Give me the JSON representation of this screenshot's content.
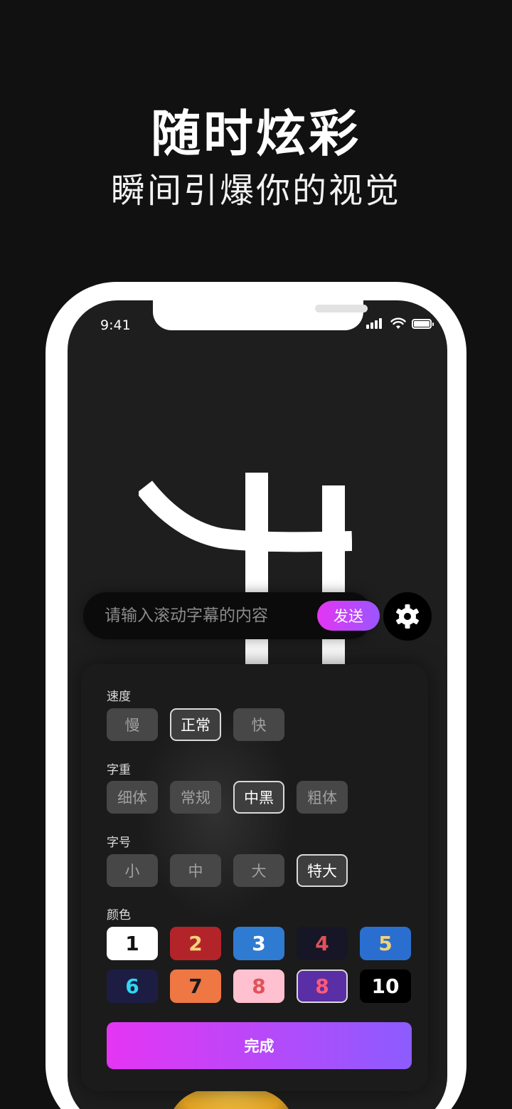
{
  "header": {
    "title": "随时炫彩",
    "subtitle": "瞬间引爆你的视觉"
  },
  "status_bar": {
    "time": "9:41",
    "signal_icon": "cellular-signal-icon",
    "wifi_icon": "wifi-icon",
    "battery_icon": "battery-icon"
  },
  "preview": {
    "glyph_icon": "scrolling-text-preview-glyph"
  },
  "input": {
    "placeholder": "请输入滚动字幕的内容",
    "value": "",
    "send_label": "发送",
    "settings_icon": "gear-icon"
  },
  "settings_panel": {
    "speed": {
      "label": "速度",
      "options": [
        "慢",
        "正常",
        "快"
      ],
      "selected": "正常"
    },
    "weight": {
      "label": "字重",
      "options": [
        "细体",
        "常规",
        "中黑",
        "粗体"
      ],
      "selected": "中黑"
    },
    "size": {
      "label": "字号",
      "options": [
        "小",
        "中",
        "大",
        "特大"
      ],
      "selected": "特大"
    },
    "color": {
      "label": "颜色",
      "swatches": [
        {
          "label": "1",
          "bg": "#ffffff",
          "fg": "#111111"
        },
        {
          "label": "2",
          "bg": "#b3242a",
          "fg": "#f5d27a"
        },
        {
          "label": "3",
          "bg": "#2f7bd1",
          "fg": "#ffffff"
        },
        {
          "label": "4",
          "bg": "#161626",
          "fg": "#e0525a"
        },
        {
          "label": "5",
          "bg": "#2a6fd0",
          "fg": "#f2d27a"
        },
        {
          "label": "6",
          "bg": "#1d1d44",
          "fg": "#2fd7f2"
        },
        {
          "label": "7",
          "bg": "#ee7744",
          "fg": "#1a1a1a"
        },
        {
          "label": "8",
          "bg": "#ffc0cf",
          "fg": "#e0525a"
        },
        {
          "label": "8",
          "bg": "#5a2ea4",
          "fg": "#ff5a78"
        },
        {
          "label": "10",
          "bg": "#000000",
          "fg": "#ffffff"
        }
      ],
      "selected_index": 8
    },
    "done_label": "完成"
  },
  "colors": {
    "accent_gradient_start": "#e535f3",
    "accent_gradient_end": "#8c5cff",
    "background": "#111111"
  }
}
